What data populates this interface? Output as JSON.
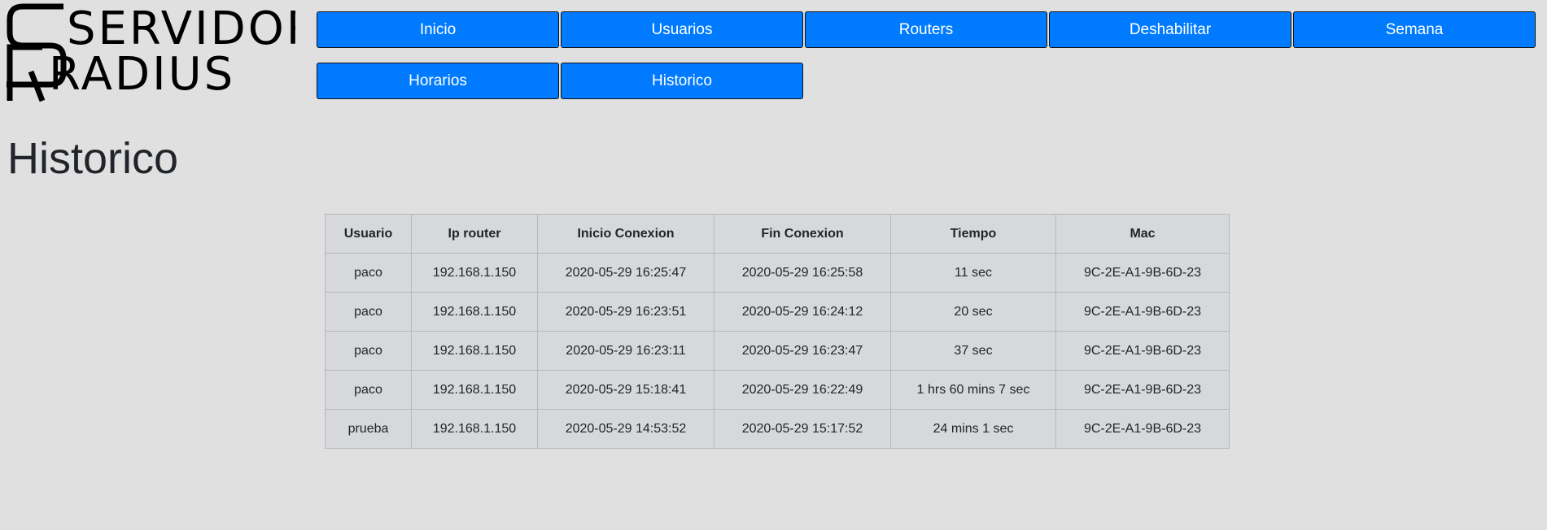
{
  "logo": {
    "line1": "SERVIDOR",
    "line2": "RADIUS"
  },
  "nav": {
    "items": [
      {
        "label": "Inicio"
      },
      {
        "label": "Usuarios"
      },
      {
        "label": "Routers"
      },
      {
        "label": "Deshabilitar"
      },
      {
        "label": "Semana"
      },
      {
        "label": "Horarios"
      },
      {
        "label": "Historico"
      }
    ]
  },
  "page": {
    "title": "Historico"
  },
  "table": {
    "headers": [
      "Usuario",
      "Ip router",
      "Inicio Conexion",
      "Fin Conexion",
      "Tiempo",
      "Mac"
    ],
    "rows": [
      [
        "paco",
        "192.168.1.150",
        "2020-05-29 16:25:47",
        "2020-05-29 16:25:58",
        "11 sec",
        "9C-2E-A1-9B-6D-23"
      ],
      [
        "paco",
        "192.168.1.150",
        "2020-05-29 16:23:51",
        "2020-05-29 16:24:12",
        "20 sec",
        "9C-2E-A1-9B-6D-23"
      ],
      [
        "paco",
        "192.168.1.150",
        "2020-05-29 16:23:11",
        "2020-05-29 16:23:47",
        "37 sec",
        "9C-2E-A1-9B-6D-23"
      ],
      [
        "paco",
        "192.168.1.150",
        "2020-05-29 15:18:41",
        "2020-05-29 16:22:49",
        "1 hrs 60 mins 7 sec",
        "9C-2E-A1-9B-6D-23"
      ],
      [
        "prueba",
        "192.168.1.150",
        "2020-05-29 14:53:52",
        "2020-05-29 15:17:52",
        "24 mins 1 sec",
        "9C-2E-A1-9B-6D-23"
      ]
    ]
  },
  "colors": {
    "background": "#e0e0e0",
    "button": "#007bff",
    "table": "#d6d8db"
  }
}
